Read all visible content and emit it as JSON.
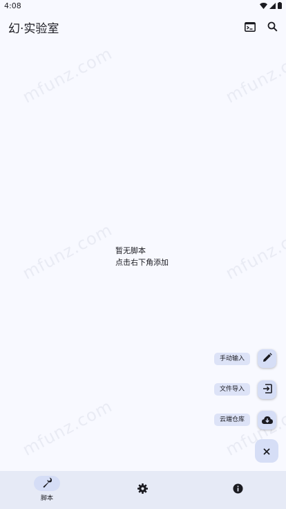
{
  "status_bar": {
    "time": "4:08",
    "icons": [
      "wifi-icon",
      "signal-icon",
      "battery-icon"
    ]
  },
  "app_bar": {
    "title": "幻·实验室",
    "actions": [
      "terminal-icon",
      "search-icon"
    ]
  },
  "watermark": "mfunz.com",
  "empty_state": {
    "line1": "暂无脚本",
    "line2": "点击右下角添加"
  },
  "fab_menu": {
    "items": [
      {
        "label": "手动输入",
        "icon": "pencil-icon"
      },
      {
        "label": "文件导入",
        "icon": "import-icon"
      },
      {
        "label": "云端仓库",
        "icon": "cloud-download-icon"
      }
    ],
    "main_icon": "close-icon"
  },
  "bottom_nav": {
    "items": [
      {
        "label": "脚本",
        "icon": "wrench-icon",
        "selected": true
      },
      {
        "label": "",
        "icon": "gear-icon",
        "selected": false
      },
      {
        "label": "",
        "icon": "info-icon",
        "selected": false
      }
    ]
  },
  "colors": {
    "background": "#f8f9ff",
    "surface_variant": "#d6def6",
    "nav_background": "#e6eaf6",
    "on_surface": "#1b1b21",
    "watermark": "#e9ebf4"
  }
}
